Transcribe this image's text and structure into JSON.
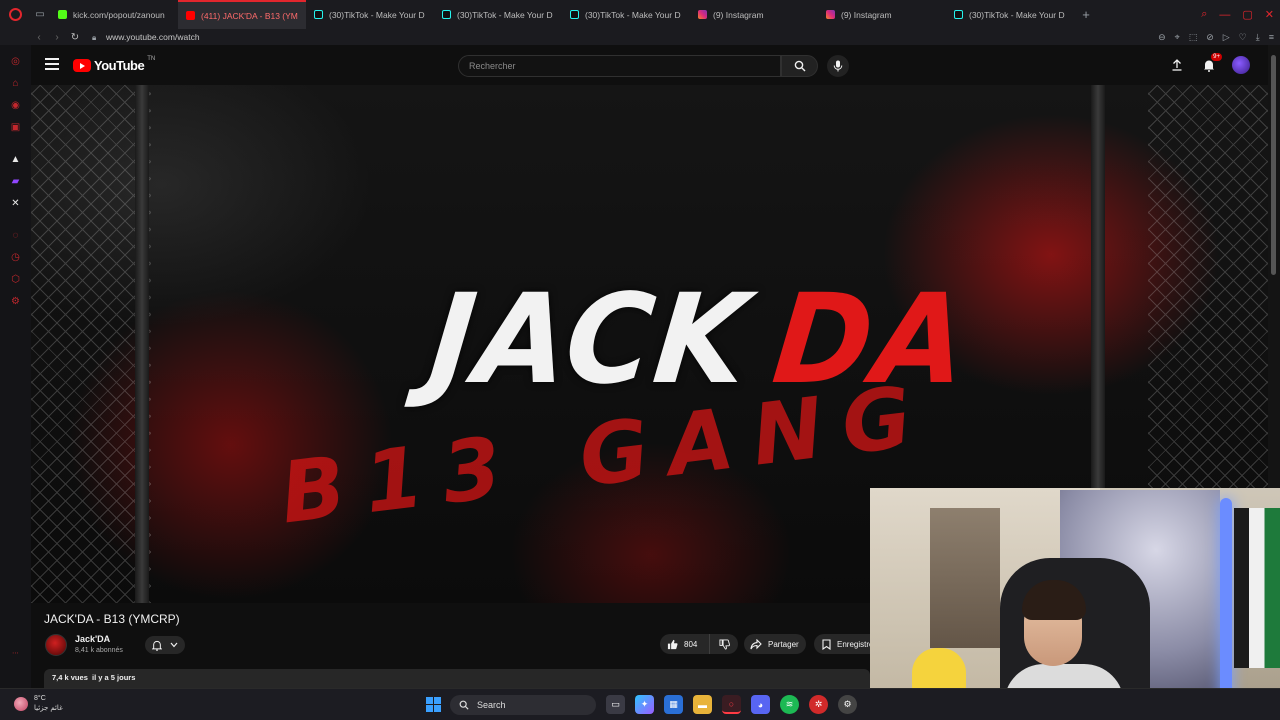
{
  "browser": {
    "tabs": [
      {
        "label": "kick.com/popout/zanoun",
        "icon": "kick-icon",
        "active": false
      },
      {
        "label": "(411) JACK'DA - B13 (YM",
        "icon": "youtube-icon",
        "active": true
      },
      {
        "label": "(30)TikTok - Make Your D",
        "icon": "tiktok-icon",
        "active": false
      },
      {
        "label": "(30)TikTok - Make Your D",
        "icon": "tiktok-icon",
        "active": false
      },
      {
        "label": "(30)TikTok - Make Your D",
        "icon": "tiktok-icon",
        "active": false
      },
      {
        "label": "(9) Instagram",
        "icon": "instagram-icon",
        "active": false
      },
      {
        "label": "(9) Instagram",
        "icon": "instagram-icon",
        "active": false
      },
      {
        "label": "(30)TikTok - Make Your D",
        "icon": "tiktok-icon",
        "active": false
      }
    ],
    "url": "www.youtube.com/watch",
    "accent": "#e2262d"
  },
  "youtube": {
    "logo_text": "YouTube",
    "logo_region": "TN",
    "search_placeholder": "Rechercher",
    "notifications_badge": "9+",
    "brand_red": "#ff0000"
  },
  "video": {
    "art_title_white": "JACK",
    "art_title_red": "DA",
    "art_b13": "B13",
    "art_gang": "GANG",
    "title": "JACK'DA - B13 (YMCRP)",
    "channel_name": "Jack'DA",
    "subscribers": "8,41 k abonnés",
    "likes": "804",
    "share_label": "Partager",
    "save_label": "Enregistrer",
    "views": "7,4 k vues",
    "published": "il y a 5 jours"
  },
  "taskbar": {
    "temperature": "8°C",
    "weather_text": "غائم جزئيا",
    "search_label": "Search"
  }
}
